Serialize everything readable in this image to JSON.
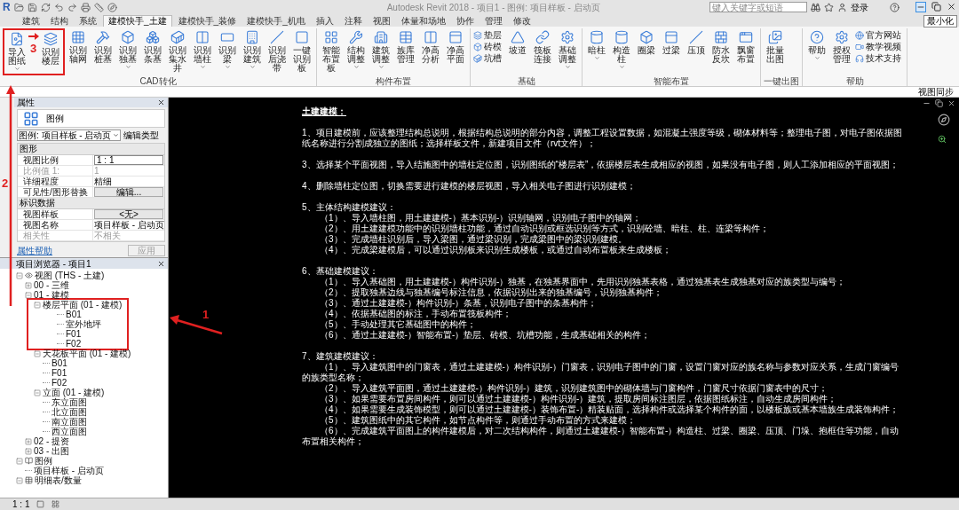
{
  "title_bar": {
    "logo": "R",
    "title": "Autodesk Revit 2018 -   项目1 - 图例: 项目样板 - 启动页",
    "search": {
      "placeholder": "键入关键字或短语"
    },
    "user": "登录",
    "tooltip": "最小化"
  },
  "tabs": [
    {
      "label": "建筑",
      "selected": false
    },
    {
      "label": "结构",
      "selected": false
    },
    {
      "label": "系统",
      "selected": false
    },
    {
      "label": "建模快手_土建",
      "selected": true
    },
    {
      "label": "建模快手_装修",
      "selected": false
    },
    {
      "label": "建模快手_机电",
      "selected": false
    },
    {
      "label": "插入",
      "selected": false
    },
    {
      "label": "注释",
      "selected": false
    },
    {
      "label": "视图",
      "selected": false
    },
    {
      "label": "体量和场地",
      "selected": false
    },
    {
      "label": "协作",
      "selected": false
    },
    {
      "label": "管理",
      "selected": false
    },
    {
      "label": "修改",
      "selected": false
    }
  ],
  "ribbon_panels": [
    {
      "title": "CAD转化",
      "buttons": [
        {
          "label": "导入图纸",
          "kind": "large",
          "dropdown": true,
          "highlighted": true
        },
        {
          "label": "识别楼层",
          "kind": "large",
          "dropdown": false,
          "highlighted": true
        },
        {
          "label": "识别轴网",
          "kind": "large",
          "dropdown": false,
          "highlighted": false
        },
        {
          "label": "识别桩基",
          "kind": "large",
          "dropdown": false,
          "highlighted": false
        },
        {
          "label": "识别独基",
          "kind": "large",
          "dropdown": true,
          "highlighted": false
        },
        {
          "label": "识别条基",
          "kind": "large",
          "dropdown": false,
          "highlighted": false
        },
        {
          "label": "识别集水井",
          "kind": "large",
          "dropdown": false,
          "highlighted": false
        },
        {
          "label": "识别墙柱",
          "kind": "large",
          "dropdown": true,
          "highlighted": false
        },
        {
          "label": "识别梁",
          "kind": "large",
          "dropdown": true,
          "highlighted": false
        },
        {
          "label": "识别建筑",
          "kind": "large",
          "dropdown": true,
          "highlighted": false
        },
        {
          "label": "识别后浇带",
          "kind": "large",
          "dropdown": false,
          "highlighted": false
        },
        {
          "label": "一键识别板",
          "kind": "large",
          "dropdown": false,
          "highlighted": false
        }
      ]
    },
    {
      "title": "构件布置",
      "buttons": [
        {
          "label": "智能布置板",
          "kind": "large",
          "dropdown": false,
          "highlighted": false
        },
        {
          "label": "结构调整",
          "kind": "large",
          "dropdown": true,
          "highlighted": false
        },
        {
          "label": "建筑调整",
          "kind": "large",
          "dropdown": true,
          "highlighted": false
        },
        {
          "label": "族库管理",
          "kind": "large",
          "dropdown": false,
          "highlighted": false
        },
        {
          "label": "净高分析",
          "kind": "large",
          "dropdown": false,
          "highlighted": false
        },
        {
          "label": "净高平面",
          "kind": "large",
          "dropdown": false,
          "highlighted": false
        }
      ]
    },
    {
      "title": "基础",
      "buttons": [
        {
          "label": "垫层",
          "kind": "small",
          "dropdown": false,
          "highlighted": false
        },
        {
          "label": "砖模",
          "kind": "small",
          "dropdown": false,
          "highlighted": false
        },
        {
          "label": "坑槽",
          "kind": "small",
          "dropdown": false,
          "highlighted": false
        },
        {
          "label": "坡道",
          "kind": "large",
          "dropdown": false,
          "highlighted": false
        },
        {
          "label": "筏板连接",
          "kind": "large",
          "dropdown": false,
          "highlighted": false
        },
        {
          "label": "基础调整",
          "kind": "large",
          "dropdown": true,
          "highlighted": false
        }
      ]
    },
    {
      "title": "智能布置",
      "buttons": [
        {
          "label": "暗柱",
          "kind": "large",
          "dropdown": true,
          "highlighted": false
        },
        {
          "label": "构造柱",
          "kind": "large",
          "dropdown": true,
          "highlighted": false
        },
        {
          "label": "圈梁",
          "kind": "large",
          "dropdown": false,
          "highlighted": false
        },
        {
          "label": "过梁",
          "kind": "large",
          "dropdown": false,
          "highlighted": false
        },
        {
          "label": "压顶",
          "kind": "large",
          "dropdown": false,
          "highlighted": false
        },
        {
          "label": "防水反坎",
          "kind": "large",
          "dropdown": false,
          "highlighted": false
        },
        {
          "label": "飘窗布置",
          "kind": "large",
          "dropdown": false,
          "highlighted": false
        }
      ]
    },
    {
      "title": "一键出图",
      "buttons": [
        {
          "label": "批量出图",
          "kind": "large",
          "dropdown": false,
          "highlighted": false
        }
      ]
    },
    {
      "title": "帮助",
      "buttons": [
        {
          "label": "帮助",
          "kind": "large",
          "dropdown": true,
          "highlighted": false
        },
        {
          "label": "授权管理",
          "kind": "large",
          "dropdown": false,
          "highlighted": false
        },
        {
          "label": "官方网站",
          "kind": "small",
          "dropdown": false,
          "highlighted": false
        },
        {
          "label": "教学视频",
          "kind": "small",
          "dropdown": false,
          "highlighted": false
        },
        {
          "label": "技术支持",
          "kind": "small",
          "dropdown": false,
          "highlighted": false
        }
      ]
    }
  ],
  "options_bar": {
    "view_sync": "视图同步"
  },
  "properties": {
    "title": "属性",
    "type_name": "图例",
    "type_selector": "图例: 项目样板 - 启动页",
    "edit_type": "编辑类型",
    "groups": [
      {
        "title": "图形",
        "rows": [
          {
            "label": "视图比例",
            "value": "1 : 1",
            "kind": "field"
          },
          {
            "label": "比例值 1:",
            "value": "1",
            "kind": "readonly"
          },
          {
            "label": "详细程度",
            "value": "精细",
            "kind": "text"
          },
          {
            "label": "可见性/图形替换",
            "value": "编辑...",
            "kind": "button"
          }
        ]
      },
      {
        "title": "标识数据",
        "rows": [
          {
            "label": "视图样板",
            "value": "<无>",
            "kind": "button"
          },
          {
            "label": "视图名称",
            "value": "项目样板 - 启动页",
            "kind": "text"
          },
          {
            "label": "相关性",
            "value": "不相关",
            "kind": "readonly"
          }
        ]
      }
    ],
    "help_link": "属性帮助",
    "apply": "应用"
  },
  "project_browser": {
    "title": "项目浏览器 - 项目1",
    "tree": [
      {
        "label": "视图 (THS - 土建)",
        "expanded": true,
        "highlighted": false,
        "children": [
          {
            "label": "00 - 三维",
            "expanded": false,
            "highlighted": false
          },
          {
            "label": "01 - 建模",
            "expanded": true,
            "highlighted": false,
            "children": [
              {
                "label": "楼层平面 (01 - 建模)",
                "expanded": true,
                "highlighted": true,
                "children": [
                  {
                    "label": "B01"
                  },
                  {
                    "label": "室外地坪"
                  },
                  {
                    "label": "F01"
                  },
                  {
                    "label": "F02"
                  }
                ]
              },
              {
                "label": "天花板平面 (01 - 建模)",
                "expanded": true,
                "highlighted": false,
                "children": [
                  {
                    "label": "B01"
                  },
                  {
                    "label": "F01"
                  },
                  {
                    "label": "F02"
                  }
                ]
              },
              {
                "label": "立面 (01 - 建模)",
                "expanded": true,
                "highlighted": false,
                "children": [
                  {
                    "label": "东立面图"
                  },
                  {
                    "label": "北立面图"
                  },
                  {
                    "label": "南立面图"
                  },
                  {
                    "label": "西立面图"
                  }
                ]
              }
            ]
          },
          {
            "label": "02 - 提资",
            "expanded": false,
            "highlighted": false
          },
          {
            "label": "03 - 出图",
            "expanded": false,
            "highlighted": false
          }
        ]
      },
      {
        "label": "图例",
        "expanded": true,
        "highlighted": false,
        "children": [
          {
            "label": "项目样板 - 启动页"
          }
        ]
      },
      {
        "label": "明细表/数量",
        "expanded": true,
        "highlighted": false
      }
    ]
  },
  "status_bar": {
    "scale": "1 : 1"
  },
  "document": {
    "heading": "土建建模：",
    "sections": [
      {
        "items": [
          {
            "kind": "para",
            "text": "1、项目建模前，应该整理结构总说明，根据结构总说明的部分内容，调整工程设置数据，如混凝土强度等级，砌体材料等；整理电子图，对电子图依据图纸名称进行分割成独立的图纸；选择样板文件，新建项目文件（rvt文件）；"
          }
        ]
      },
      {
        "items": [
          {
            "kind": "para",
            "text": "3、选择某个平面视图，导入结施图中的墙柱定位图，识别图纸的“楼层表”，依据楼层表生成相应的视图，如果没有电子图，则人工添加相应的平面视图；"
          }
        ]
      },
      {
        "items": [
          {
            "kind": "para",
            "text": "4、删除墙柱定位图，切换需要进行建模的楼层视图，导入相关电子图进行识别建模；"
          }
        ]
      },
      {
        "items": [
          {
            "kind": "para",
            "text": "5、主体结构建模建议："
          },
          {
            "kind": "item",
            "text": "（1）、导入墙柱图，用土建建模-）基本识别-）识别轴网，识别电子图中的轴网；"
          },
          {
            "kind": "item",
            "text": "（2）、用土建建模功能中的识别墙柱功能，通过自动识别或框选识别等方式，识别砼墙、暗柱、柱、连梁等构件；"
          },
          {
            "kind": "item",
            "text": "（3）、完成墙柱识别后，导入梁图，通过梁识别，完成梁图中的梁识别建模。"
          },
          {
            "kind": "item",
            "text": "（4）、完成梁建模后，可以通过识别板来识别生成楼板，或通过自动布置板来生成楼板；"
          }
        ]
      },
      {
        "items": [
          {
            "kind": "para",
            "text": "6、基础建模建议："
          },
          {
            "kind": "item",
            "text": "（1）、导入基础图，用土建建模-）构件识别-）独基，在独基界面中，先用识别独基表格，通过独基表生成独基对应的族类型与编号；"
          },
          {
            "kind": "item",
            "text": "（2）、提取独基边线与独基编号标注信息，依据识别出来的独基编号，识别独基构件；"
          },
          {
            "kind": "item",
            "text": "（3）、通过土建建模-）构件识别-）条基，识别电子图中的条基构件；"
          },
          {
            "kind": "item",
            "text": "（4）、依据基础图的标注，手动布置筏板构件；"
          },
          {
            "kind": "item",
            "text": "（5）、手动处理其它基础图中的构件；"
          },
          {
            "kind": "item",
            "text": "（6）、通过土建建模-）智能布置-）垫层、砖模、坑槽功能，生成基础相关的构件；"
          }
        ]
      },
      {
        "items": [
          {
            "kind": "para",
            "text": "7、建筑建模建议："
          },
          {
            "kind": "item",
            "text": "（1）、导入建筑图中的门窗表，通过土建建模-）构件识别-）门窗表，识别电子图中的门窗，设置门窗对应的族名称与参数对应关系，生成门窗编号的族类型名称；"
          },
          {
            "kind": "item",
            "text": "（2）、导入建筑平面图，通过土建建模-）构件识别-）建筑，识别建筑图中的砌体墙与门窗构件，门窗尺寸依据门窗表中的尺寸；"
          },
          {
            "kind": "item",
            "text": "（3）、如果需要布置房间构件，则可以通过土建建模-）构件识别-）建筑，提取房间标注图层，依据图纸标注，自动生成房间构件；"
          },
          {
            "kind": "item",
            "text": "（4）、如果需要生成装饰模型，则可以通过土建建模-）装饰布置-）精装贴面，选择构件或选择某个构件的面，以楼板族或基本墙族生成装饰构件；"
          },
          {
            "kind": "item",
            "text": "（5）、建筑图纸中的其它构件，如节点构件等，则通过手动布置的方式来建模；"
          },
          {
            "kind": "item",
            "text": "（6）、完成建筑平面图上的构件建模后，对二次结构构件，则通过土建建模-）智能布置-）构造柱、过梁、圈梁、压顶、门垛、抱框住等功能，自动布置相关构件；"
          }
        ]
      }
    ]
  },
  "annotations": [
    {
      "label": "1"
    },
    {
      "label": "2"
    },
    {
      "label": "3"
    }
  ]
}
